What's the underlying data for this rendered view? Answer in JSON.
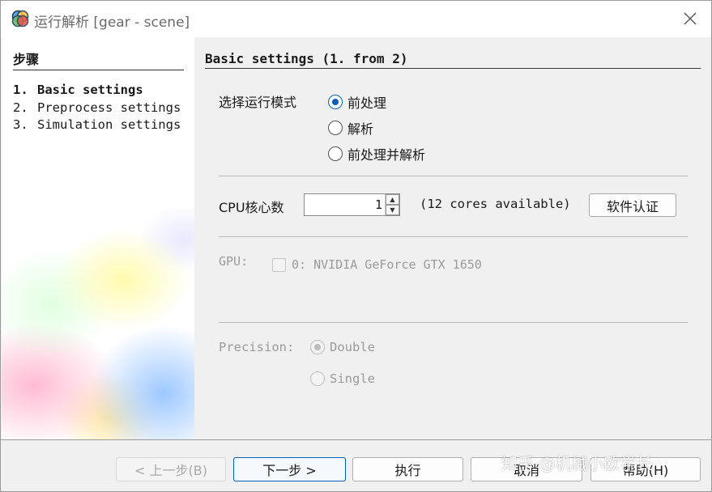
{
  "window": {
    "title": "运行解析 [gear - scene]",
    "icon": "app-logo-icon"
  },
  "steps": {
    "heading": "步骤",
    "items": [
      {
        "num": "1.",
        "label": "Basic settings",
        "active": true
      },
      {
        "num": "2.",
        "label": "Preprocess settings",
        "active": false
      },
      {
        "num": "3.",
        "label": "Simulation settings",
        "active": false
      }
    ]
  },
  "main": {
    "heading": "Basic settings (1. from 2)",
    "mode": {
      "label": "选择运行模式",
      "options": [
        {
          "label": "前处理",
          "checked": true
        },
        {
          "label": "解析",
          "checked": false
        },
        {
          "label": "前处理并解析",
          "checked": false
        }
      ]
    },
    "cpu": {
      "label": "CPU核心数",
      "value": "1",
      "available": "(12 cores available)",
      "license_button": "软件认证"
    },
    "gpu": {
      "label": "GPU:",
      "device": "0: NVIDIA GeForce GTX 1650",
      "checked": false,
      "enabled": false
    },
    "precision": {
      "label": "Precision:",
      "options": [
        {
          "label": "Double",
          "checked": true
        },
        {
          "label": "Single",
          "checked": false
        }
      ],
      "enabled": false
    }
  },
  "buttons": {
    "prev": "< 上一步(B)",
    "next": "下一步 >",
    "run": "执行",
    "cancel": "取消",
    "help": "帮助(H)"
  },
  "watermark": "知乎 @机械小欧学长",
  "colors": {
    "accent": "#0a5fb4",
    "disabled_text": "#9a9a9a",
    "window_bg": "#f0f0f0"
  }
}
